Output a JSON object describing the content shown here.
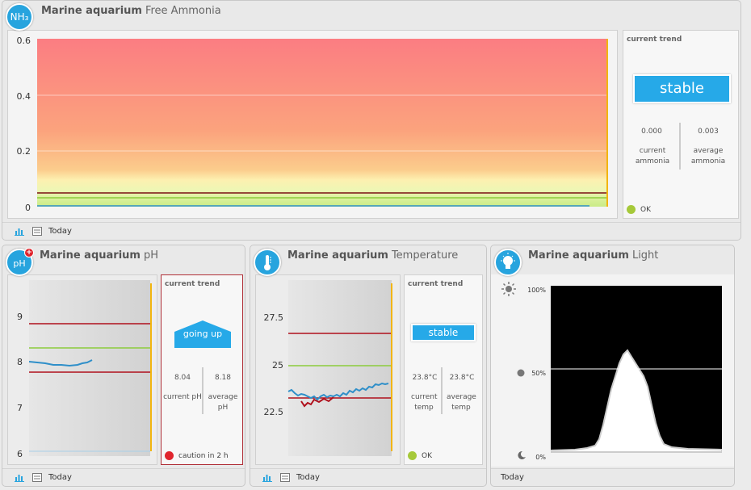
{
  "ammonia": {
    "badge": "NH₃",
    "name": "Marine aquarium",
    "measure": "Free Ammonia",
    "y_ticks": [
      "0.6",
      "0.4",
      "0.2",
      "0"
    ],
    "trend_label": "current trend",
    "trend": "stable",
    "current_value": "0.000",
    "current_label": "current ammonia",
    "average_value": "0.003",
    "average_label": "average ammonia",
    "status": "OK",
    "status_color": "#a6c93a",
    "footer": "Today"
  },
  "ph": {
    "badge": "pH",
    "name": "Marine aquarium",
    "measure": "pH",
    "y_ticks": [
      "9",
      "8",
      "7",
      "6"
    ],
    "trend_label": "current trend",
    "trend": "going up",
    "current_value": "8.04",
    "current_label": "current pH",
    "average_value": "8.18",
    "average_label": "average pH",
    "status": "caution in 2 h",
    "status_color": "#e0252d",
    "footer": "Today"
  },
  "temp": {
    "name": "Marine aquarium",
    "measure": "Temperature",
    "y_ticks": [
      "27.5",
      "25",
      "22.5"
    ],
    "trend_label": "current trend",
    "trend": "stable",
    "current_value": "23.8°C",
    "current_label": "current temp",
    "average_value": "23.8°C",
    "average_label": "average temp",
    "status": "OK",
    "status_color": "#a6c93a",
    "footer": "Today"
  },
  "light": {
    "name": "Marine aquarium",
    "measure": "Light",
    "y_ticks": [
      "100%",
      "50%",
      "0%"
    ],
    "footer": "Today"
  },
  "icons": {
    "chart": "bar-chart-icon",
    "table": "table-icon",
    "thermometer": "thermometer-icon",
    "bulb": "lightbulb-icon",
    "sun": "sun-icon",
    "moon": "moon-icon"
  },
  "colors": {
    "accent": "#27a4de",
    "limit_red": "#b0101c",
    "ok_green": "#a6c93a",
    "series_blue": "#2f8fc9",
    "now_marker": "#f2b50e"
  }
}
